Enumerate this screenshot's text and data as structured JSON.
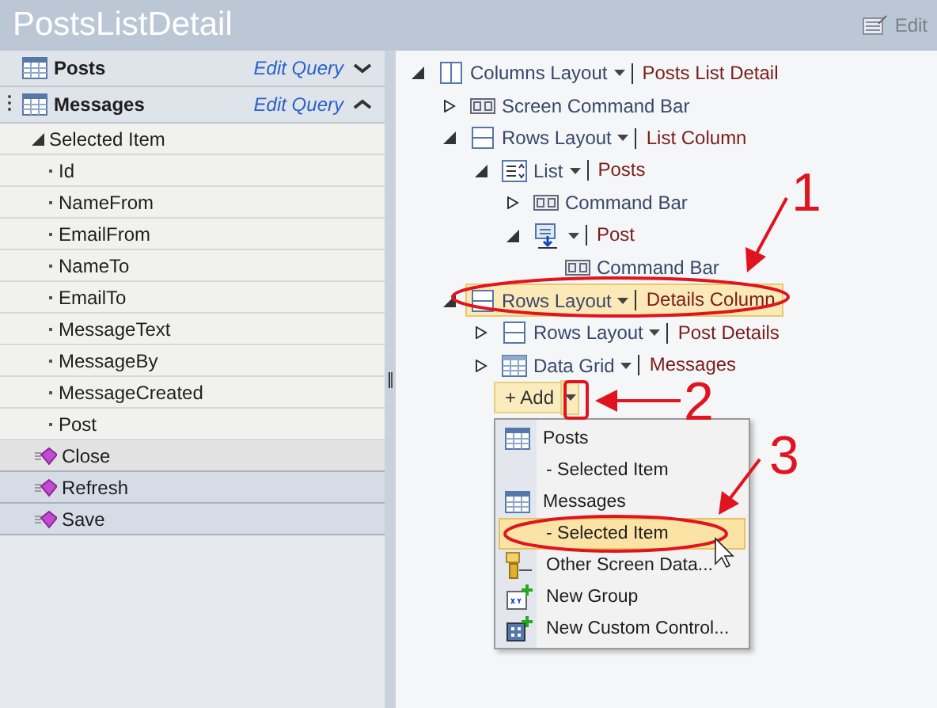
{
  "header": {
    "title": "PostsListDetail",
    "edit_button": "Edit"
  },
  "data_panel": {
    "collections": [
      {
        "name": "Posts",
        "link": "Edit Query",
        "expanded": false
      },
      {
        "name": "Messages",
        "link": "Edit Query",
        "expanded": true,
        "children": [
          {
            "name": "Selected Item",
            "expanded": true,
            "children": [
              {
                "name": "Id"
              },
              {
                "name": "NameFrom"
              },
              {
                "name": "EmailFrom"
              },
              {
                "name": "NameTo"
              },
              {
                "name": "EmailTo"
              },
              {
                "name": "MessageText"
              },
              {
                "name": "MessageBy"
              },
              {
                "name": "MessageCreated"
              },
              {
                "name": "Post"
              }
            ]
          }
        ]
      }
    ],
    "commands": [
      {
        "name": "Close",
        "selected": true
      },
      {
        "name": "Refresh",
        "selected": false
      },
      {
        "name": "Save",
        "selected": false
      }
    ]
  },
  "tree": [
    {
      "kind": "columns",
      "control": "Columns Layout",
      "binding": "Posts List Detail",
      "expanded": true,
      "selected": false,
      "children": [
        {
          "kind": "commandbar",
          "control": "Screen Command Bar",
          "expanded": false,
          "selected": false
        },
        {
          "kind": "rows",
          "control": "Rows Layout",
          "binding": "List Column",
          "expanded": true,
          "selected": false,
          "children": [
            {
              "kind": "list",
              "control": "List",
              "binding": "Posts",
              "expanded": true,
              "selected": false,
              "children": [
                {
                  "kind": "commandbar",
                  "control": "Command Bar",
                  "expanded": false,
                  "selected": false
                },
                {
                  "kind": "item",
                  "binding": "Post",
                  "expanded": true,
                  "selected": false,
                  "children": [
                    {
                      "kind": "commandbar",
                      "control": "Command Bar",
                      "selected": false
                    }
                  ]
                }
              ]
            }
          ]
        },
        {
          "kind": "rows",
          "control": "Rows Layout",
          "binding": "Details Column",
          "expanded": true,
          "selected": true,
          "children": [
            {
              "kind": "rows",
              "control": "Rows Layout",
              "binding": "Post Details",
              "expanded": false,
              "selected": false
            },
            {
              "kind": "grid",
              "control": "Data Grid",
              "binding": "Messages",
              "expanded": false,
              "selected": false
            }
          ]
        }
      ]
    }
  ],
  "add_button": {
    "label": "+ Add"
  },
  "add_menu": [
    {
      "kind": "table",
      "label": "Posts",
      "selected": false
    },
    {
      "kind": "plain",
      "label": "- Selected Item",
      "selected": false
    },
    {
      "kind": "table",
      "label": "Messages",
      "selected": false
    },
    {
      "kind": "plain",
      "label": "- Selected Item",
      "selected": true
    },
    {
      "kind": "data",
      "label": "Other Screen Data...",
      "selected": false
    },
    {
      "kind": "group",
      "label": "New Group",
      "selected": false
    },
    {
      "kind": "custom",
      "label": "New Custom Control...",
      "selected": false
    }
  ],
  "annotations": [
    {
      "label": "1"
    },
    {
      "label": "2"
    },
    {
      "label": "3"
    }
  ]
}
